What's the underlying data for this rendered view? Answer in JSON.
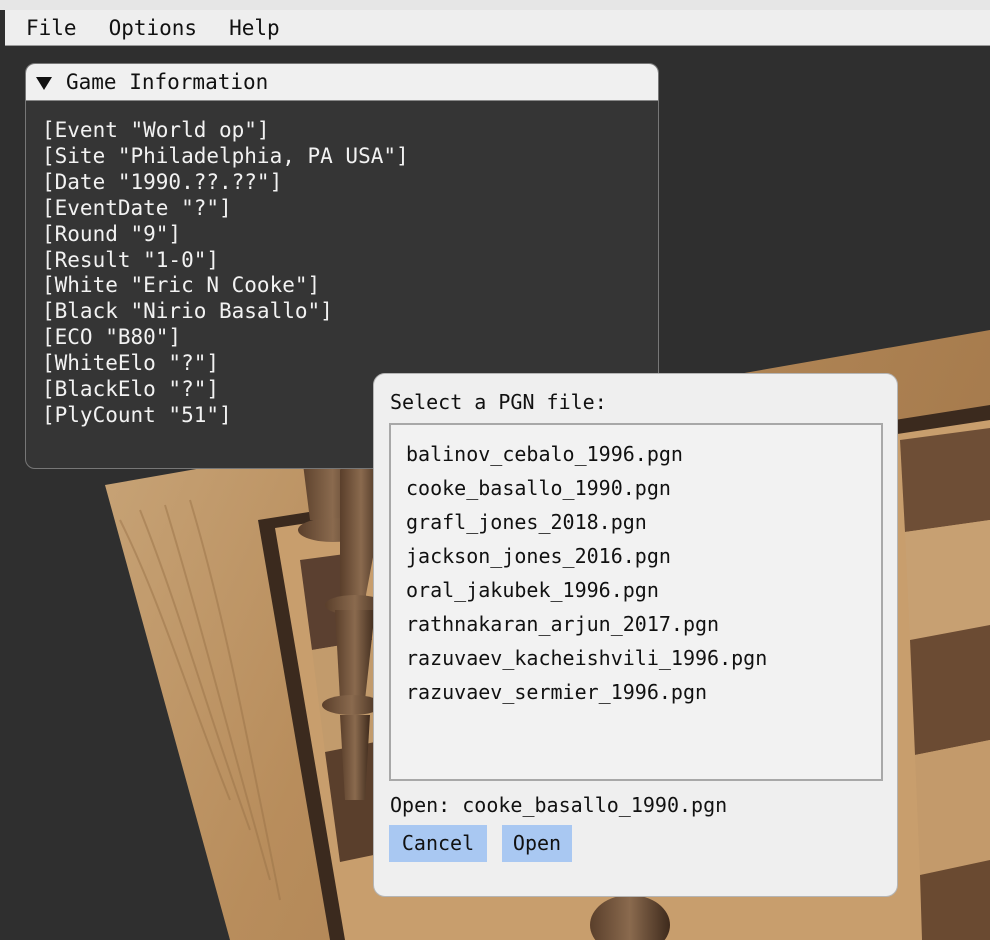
{
  "menu": {
    "items": [
      "File",
      "Options",
      "Help"
    ]
  },
  "game_info": {
    "title": "Game Information",
    "tags": [
      "[Event \"World op\"]",
      "[Site \"Philadelphia, PA USA\"]",
      "[Date \"1990.??.??\"]",
      "[EventDate \"?\"]",
      "[Round \"9\"]",
      "[Result \"1-0\"]",
      "[White \"Eric N Cooke\"]",
      "[Black \"Nirio Basallo\"]",
      "[ECO \"B80\"]",
      "[WhiteElo \"?\"]",
      "[BlackElo \"?\"]",
      "[PlyCount \"51\"]"
    ]
  },
  "file_dialog": {
    "title": "Select a PGN file:",
    "files": [
      "balinov_cebalo_1996.pgn",
      "cooke_basallo_1990.pgn",
      "grafl_jones_2018.pgn",
      "jackson_jones_2016.pgn",
      "oral_jakubek_1996.pgn",
      "rathnakaran_arjun_2017.pgn",
      "razuvaev_kacheishvili_1996.pgn",
      "razuvaev_sermier_1996.pgn"
    ],
    "open_label": "Open: cooke_basallo_1990.pgn",
    "cancel_label": "Cancel",
    "open_button_label": "Open"
  }
}
